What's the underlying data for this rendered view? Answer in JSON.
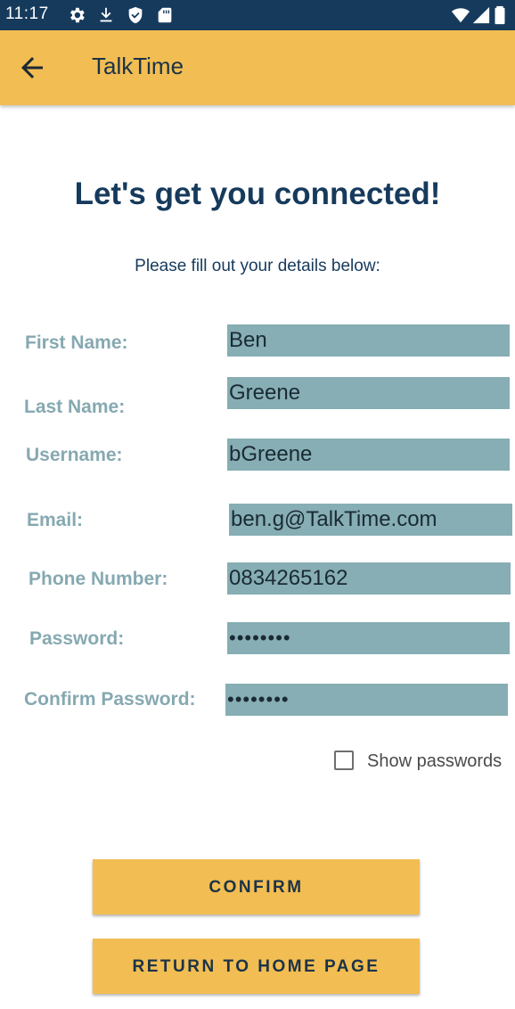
{
  "status_bar": {
    "time": "11:17",
    "icons": [
      "gear-icon",
      "download-icon",
      "shield-icon",
      "sd-card-icon",
      "wifi-icon",
      "cell-signal-icon",
      "battery-icon"
    ]
  },
  "app_bar": {
    "title": "TalkTime",
    "back_icon": "arrow-left-icon"
  },
  "heading": "Let's get you connected!",
  "subheading": "Please fill out your details below:",
  "form": {
    "first_name": {
      "label": "First Name:",
      "value": "Ben"
    },
    "last_name": {
      "label": "Last Name:",
      "value": "Greene"
    },
    "username": {
      "label": "Username:",
      "value": "bGreene"
    },
    "email": {
      "label": "Email:",
      "value": "ben.g@TalkTime.com"
    },
    "phone": {
      "label": "Phone Number:",
      "value": "0834265162"
    },
    "password": {
      "label": "Password:",
      "value": "••••••••"
    },
    "confirm_password": {
      "label": "Confirm Password:",
      "value": "••••••••"
    },
    "show_passwords": {
      "label": "Show passwords",
      "checked": false
    }
  },
  "buttons": {
    "confirm": "CONFIRM",
    "return_home": "RETURN TO HOME PAGE"
  },
  "colors": {
    "status_bar": "#163a5c",
    "accent": "#f2bd52",
    "heading": "#163a5c",
    "label": "#86a9b1",
    "field_bg": "#86aeb4"
  }
}
